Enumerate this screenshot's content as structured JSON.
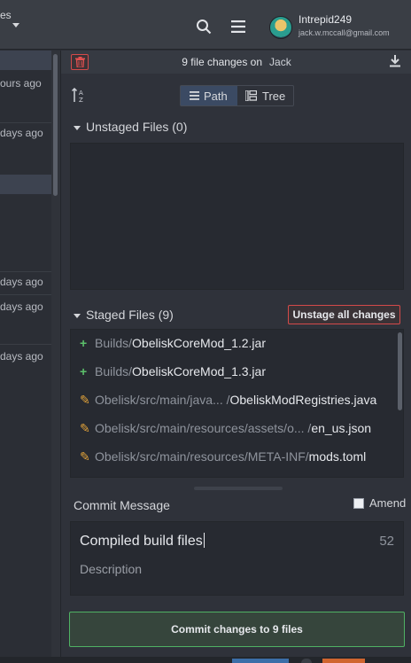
{
  "topbar": {
    "branch_fragment": "es",
    "username": "Intrepid249",
    "email": "jack.w.mccall@gmail.com",
    "icons": [
      "search-icon",
      "hamburger-menu-icon",
      "chevron-down-icon"
    ]
  },
  "history": {
    "rows": [
      {
        "text": "ours ago"
      },
      {
        "text": "days ago"
      },
      {
        "text": "days ago"
      },
      {
        "text": "days ago"
      },
      {
        "text": "days ago"
      }
    ]
  },
  "panel": {
    "header": {
      "changes_text": "9 file changes on",
      "branch": "Jack",
      "icons": [
        "trash-icon",
        "download-icon"
      ]
    },
    "view_toggle": {
      "path_label": "Path",
      "tree_label": "Tree",
      "selected": "Path"
    },
    "unstaged": {
      "title": "Unstaged Files (0)"
    },
    "staged": {
      "title": "Staged Files (9)",
      "unstage_all_label": "Unstage all changes",
      "files": [
        {
          "status": "added",
          "dir": "Builds/",
          "name": "ObeliskCoreMod_1.2.jar"
        },
        {
          "status": "added",
          "dir": "Builds/",
          "name": "ObeliskCoreMod_1.3.jar"
        },
        {
          "status": "modified",
          "dir": "Obelisk/src/main/java... /",
          "name": "ObeliskModRegistries.java"
        },
        {
          "status": "modified",
          "dir": "Obelisk/src/main/resources/assets/o... /",
          "name": "en_us.json"
        },
        {
          "status": "modified",
          "dir": "Obelisk/src/main/resources/META-INF/",
          "name": "mods.toml"
        }
      ]
    },
    "commit": {
      "label": "Commit Message",
      "amend_label": "Amend",
      "amend_checked": false,
      "summary": "Compiled build files",
      "char_count": "52",
      "description_placeholder": "Description",
      "button_label": "Commit changes to 9 files"
    }
  },
  "colors": {
    "accent_green": "#4fb163",
    "danger_red": "#d44a4a",
    "modified_orange": "#e2a33a",
    "selected_blue": "#3b4a63"
  }
}
